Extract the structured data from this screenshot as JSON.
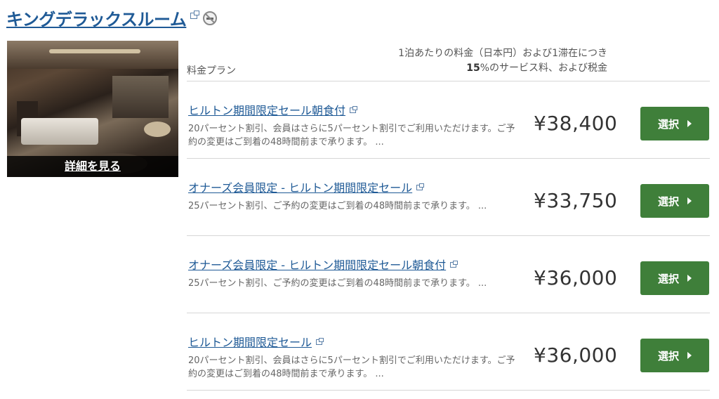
{
  "room": {
    "title": "キングデラックスルーム",
    "details_link": "詳細を見る"
  },
  "table_header": {
    "plan_label": "料金プラン",
    "price_note_line1": "1泊あたりの料金（日本円）および1滞在につき",
    "price_note_percent": "15",
    "price_note_line2_rest": "%のサービス料、および税金"
  },
  "plans": [
    {
      "name": "ヒルトン期間限定セール朝食付",
      "description": "20パーセント割引、会員はさらに5パーセント割引でご利用いただけます。ご予約の変更はご到着の48時間前まで承ります。 ...",
      "price": "¥38,400",
      "button": "選択"
    },
    {
      "name": "オナーズ会員限定 - ヒルトン期間限定セール",
      "description": "25パーセント割引、ご予約の変更はご到着の48時間前まで承ります。 ...",
      "price": "¥33,750",
      "button": "選択"
    },
    {
      "name": "オナーズ会員限定 - ヒルトン期間限定セール朝食付",
      "description": "25パーセント割引、ご予約の変更はご到着の48時間前まで承ります。 ...",
      "price": "¥36,000",
      "button": "選択"
    },
    {
      "name": "ヒルトン期間限定セール",
      "description": "20パーセント割引、会員はさらに5パーセント割引でご利用いただけます。ご予約の変更はご到着の48時間前まで承ります。 ...",
      "price": "¥36,000",
      "button": "選択"
    }
  ],
  "icons": {
    "external": "external-link-icon",
    "nosmoking": "no-smoking-icon",
    "arrow": "caret-right-icon"
  },
  "colors": {
    "link": "#1f5a96",
    "button": "#3f7f3a",
    "divider": "#d6d6d6"
  }
}
